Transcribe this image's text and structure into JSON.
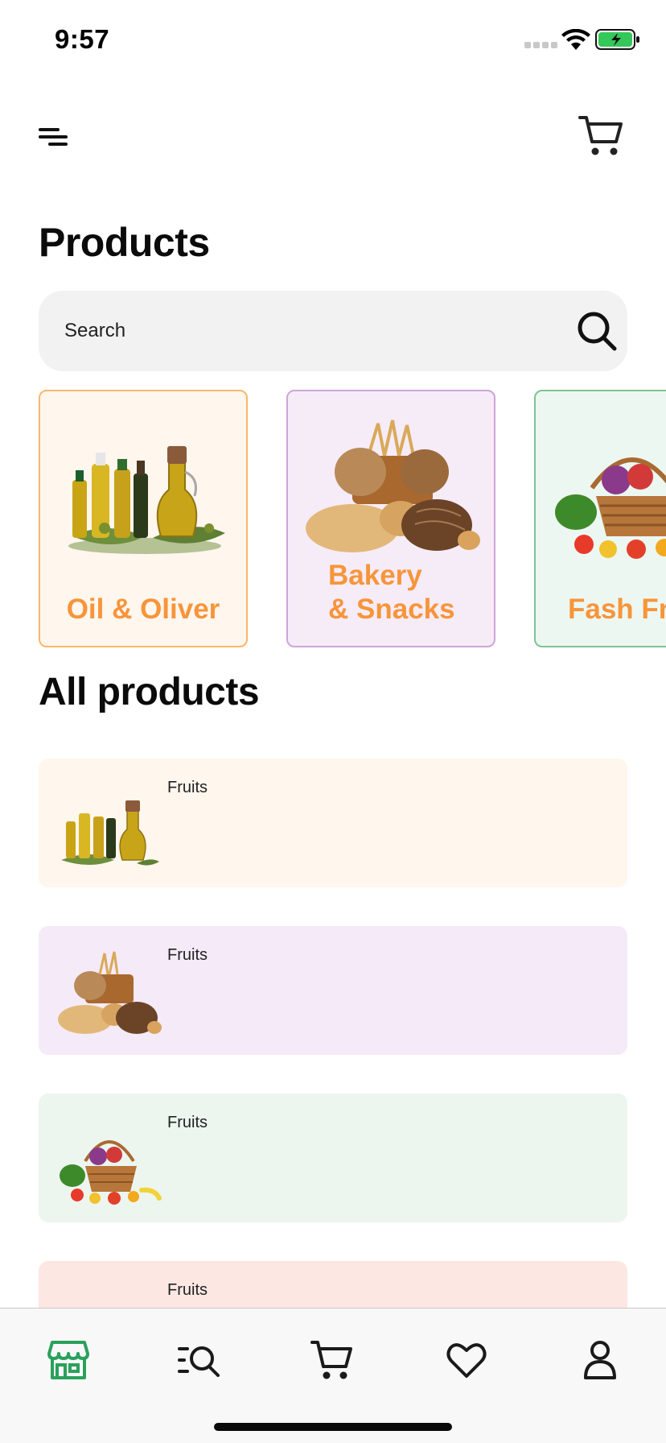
{
  "status_bar": {
    "time": "9:57"
  },
  "header": {
    "title": "Products"
  },
  "search": {
    "placeholder": "Search"
  },
  "categories": [
    {
      "label": "Oil & Oliver",
      "image": "olive-oil-bottles"
    },
    {
      "label": "Bakery\n& Snacks",
      "line1": "Bakery",
      "line2": "& Snacks",
      "image": "bread-basket"
    },
    {
      "label": "Fash Fruits",
      "image": "vegetable-basket"
    }
  ],
  "all_products": {
    "title": "All products",
    "items": [
      {
        "name": "Fruits",
        "image": "olive-oil-bottles"
      },
      {
        "name": "Fruits",
        "image": "bread-basket"
      },
      {
        "name": "Fruits",
        "image": "vegetable-basket"
      },
      {
        "name": "Fruits",
        "image": "meat"
      }
    ]
  },
  "tab_bar": {
    "items": [
      {
        "name": "store",
        "icon": "store-icon",
        "active": true
      },
      {
        "name": "explore",
        "icon": "explore-icon",
        "active": false
      },
      {
        "name": "cart",
        "icon": "cart-icon",
        "active": false
      },
      {
        "name": "favourite",
        "icon": "heart-icon",
        "active": false
      },
      {
        "name": "account",
        "icon": "user-icon",
        "active": false
      }
    ]
  },
  "colors": {
    "accent_orange": "#f7953a",
    "active_tab_green": "#2aa15b",
    "oil_card_bg": "#fff6ee",
    "bakery_card_bg": "#f6ecf8",
    "fruit_card_bg": "#edf7f1",
    "meat_card_bg": "#fde7e3"
  }
}
